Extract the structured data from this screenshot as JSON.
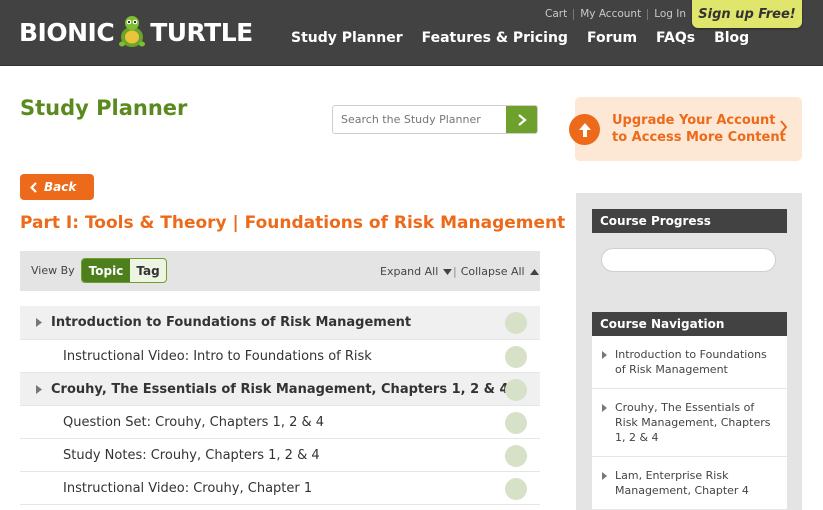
{
  "header": {
    "logo_left": "BIONIC",
    "logo_right": "TURTLE",
    "util_links": [
      "Cart",
      "My Account",
      "Log In"
    ],
    "signup": "Sign up Free!",
    "nav": [
      "Study Planner",
      "Features & Pricing",
      "Forum",
      "FAQs",
      "Blog"
    ]
  },
  "page": {
    "title": "Study Planner",
    "search_placeholder": "Search the Study Planner",
    "back": "Back",
    "section_title": "Part I: Tools & Theory | Foundations of Risk Management"
  },
  "upgrade": {
    "line1": "Upgrade Your Account",
    "line2": "to Access More Content"
  },
  "toolbar": {
    "view_by": "View By",
    "topic": "Topic",
    "tag": "Tag",
    "expand_all": "Expand All",
    "collapse_all": "Collapse All"
  },
  "list": [
    {
      "label": "Introduction to Foundations of Risk Management",
      "type": "parent"
    },
    {
      "label": "Instructional Video: Intro to Foundations of Risk",
      "type": "child"
    },
    {
      "label": "Crouhy, The Essentials of Risk Management, Chapters 1, 2 & 4",
      "type": "parent"
    },
    {
      "label": "Question Set: Crouhy, Chapters 1, 2 & 4",
      "type": "child"
    },
    {
      "label": "Study Notes: Crouhy, Chapters 1, 2 & 4",
      "type": "child"
    },
    {
      "label": "Instructional Video: Crouhy, Chapter 1",
      "type": "child"
    }
  ],
  "sidebar": {
    "progress_title": "Course Progress",
    "nav_title": "Course Navigation",
    "nav_items": [
      "Introduction to Foundations of Risk Management",
      "Crouhy, The Essentials of Risk Management, Chapters 1, 2 & 4",
      "Lam, Enterprise Risk Management, Chapter 4"
    ]
  },
  "colors": {
    "header_bg": "#424242",
    "brand_green": "#5a8a1e",
    "accent_orange": "#ec6a1a",
    "signup_yellow": "#dfe66b"
  }
}
